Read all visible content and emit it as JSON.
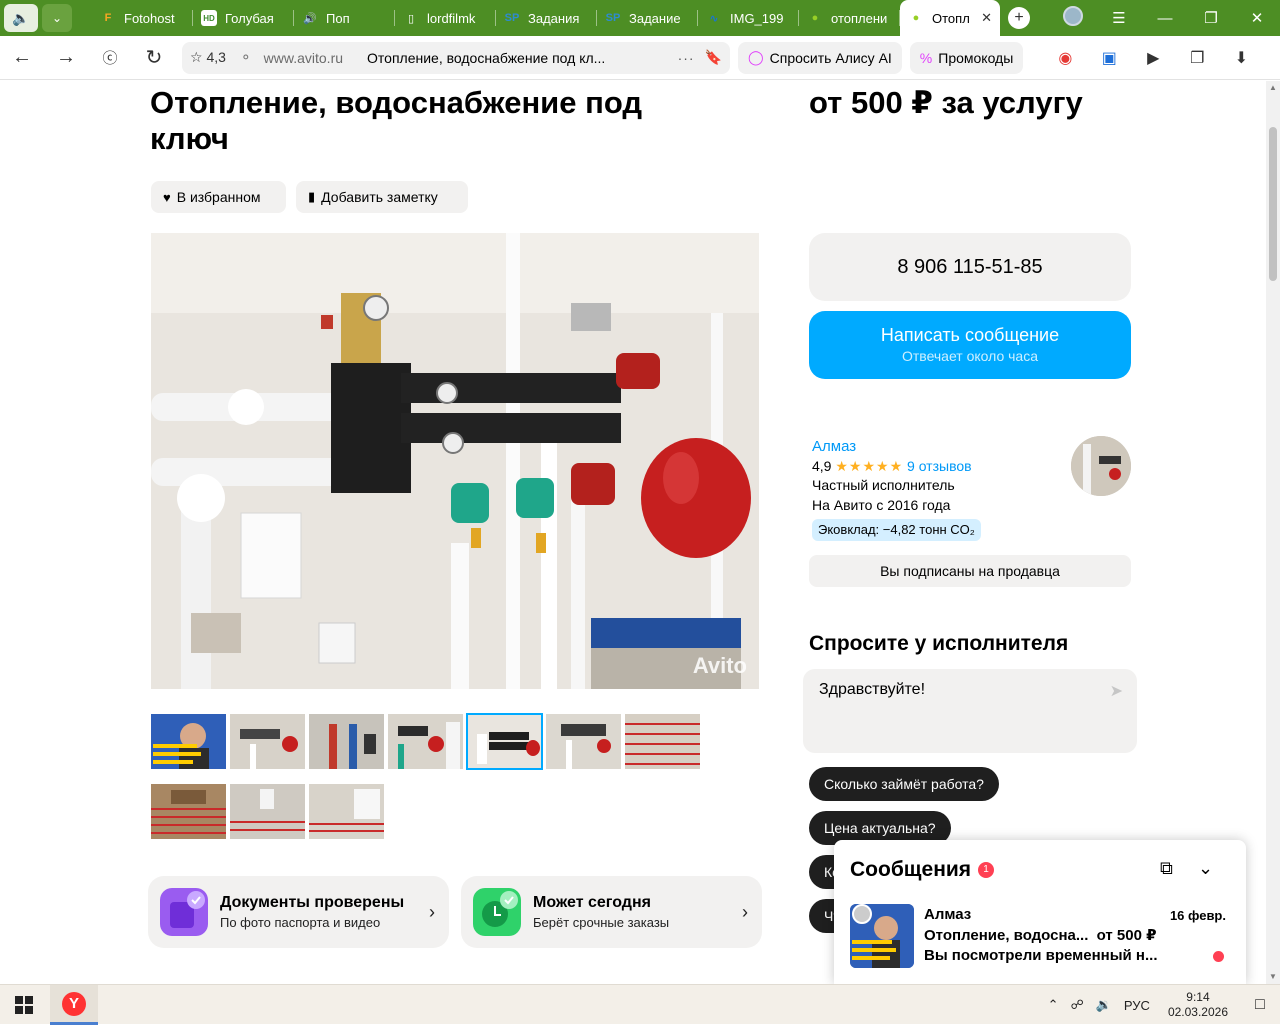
{
  "browser": {
    "tabs": [
      {
        "title": "Fotohost",
        "favicon": "F",
        "favicon_color": "#f5a623"
      },
      {
        "title": "Голубая",
        "favicon": "HD",
        "favicon_color": "#3d8b2f"
      },
      {
        "title": "Поп",
        "favicon": "sound-icon",
        "favicon_color": "#e53935"
      },
      {
        "title": "lordfilmk",
        "favicon": "doc-icon",
        "favicon_color": "#ffffff"
      },
      {
        "title": "Задания",
        "favicon": "SP",
        "favicon_color": "#2e8bd0"
      },
      {
        "title": "Задание",
        "favicon": "SP",
        "favicon_color": "#2e8bd0"
      },
      {
        "title": "IMG_199",
        "favicon": "wave-icon",
        "favicon_color": "#1976d2"
      },
      {
        "title": "отоплени",
        "favicon": "avito-icon",
        "favicon_color": "#97cf26"
      },
      {
        "title": "Отопл",
        "favicon": "avito-icon",
        "favicon_color": "#97cf26",
        "active": true
      }
    ],
    "address": {
      "rating": "4,3",
      "domain": "www.avito.ru",
      "page_title": "Отопление, водоснабжение под кл..."
    },
    "alice_label": "Спросить Алису AI",
    "promo_label": "Промокоды"
  },
  "listing": {
    "title": "Отопление, водоснабжение под ключ",
    "price": "от 500 ₽ за услугу",
    "favorite_label": "В избранном",
    "note_label": "Добавить заметку",
    "watermark": "Avito",
    "badges": [
      {
        "title": "Документы проверены",
        "subtitle": "По фото паспорта и видео"
      },
      {
        "title": "Может сегодня",
        "subtitle": "Берёт срочные заказы"
      }
    ]
  },
  "contact": {
    "phone": "8 906 115-51-85",
    "message_label": "Написать сообщение",
    "message_sub": "Отвечает около часа"
  },
  "seller": {
    "name": "Алмаз",
    "rating": "4,9",
    "stars": "★★★★★",
    "reviews": "9 отзывов",
    "type": "Частный исполнитель",
    "since": "На Авито с 2016 года",
    "eco": "Эковклад: −4,82 тонн CO₂",
    "subscribed_label": "Вы подписаны на продавца"
  },
  "ask": {
    "heading": "Спросите у исполнителя",
    "input_value": "Здравствуйте!",
    "quick_questions": [
      "Сколько займёт работа?",
      "Цена актуальна?",
      "Когда",
      "Что"
    ]
  },
  "messenger": {
    "title": "Сообщения",
    "count": "1",
    "conversation": {
      "name": "Алмаз",
      "date": "16 февр.",
      "subject": "Отопление, водосна...",
      "price": "от 500 ₽",
      "preview": "Вы посмотрели временный н..."
    }
  },
  "taskbar": {
    "language": "РУС",
    "time": "9:14",
    "date": "02.03.2026"
  }
}
